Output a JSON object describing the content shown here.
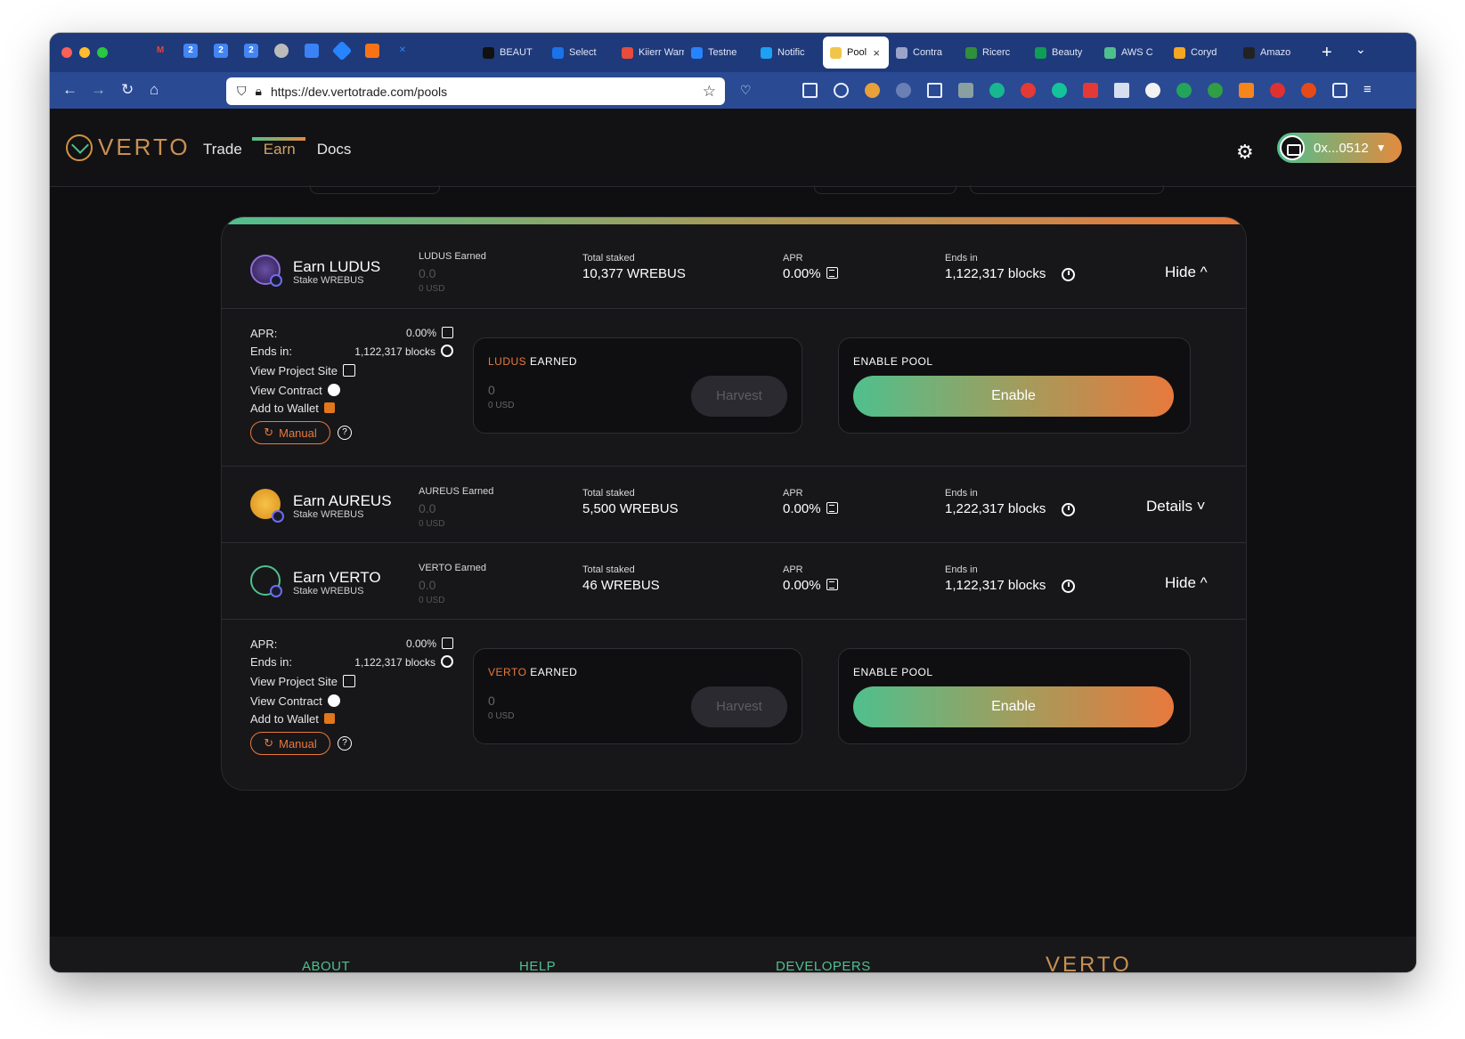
{
  "browser": {
    "tabs": [
      {
        "label": "BEAUT",
        "color": "#111111"
      },
      {
        "label": "Select",
        "color": "#1a73e8"
      },
      {
        "label": "Kiierr Warr",
        "color": "#e74c3c"
      },
      {
        "label": "Testne",
        "color": "#2684ff"
      },
      {
        "label": "Notific",
        "color": "#1da1f2"
      },
      {
        "label": "Pool",
        "color": "#f0c64a",
        "active": true
      },
      {
        "label": "Contra",
        "color": "#9aa4c8"
      },
      {
        "label": "Ricerc",
        "color": "#2f8f3a"
      },
      {
        "label": "Beauty",
        "color": "#0f9d58"
      },
      {
        "label": "AWS C",
        "color": "#4fc08d"
      },
      {
        "label": "Coryd",
        "color": "#f5a623"
      },
      {
        "label": "Amazo",
        "color": "#222222"
      }
    ],
    "url": "https://dev.vertotrade.com/pools"
  },
  "header": {
    "logo_text": "VERTO",
    "nav": [
      "Trade",
      "Earn",
      "Docs"
    ],
    "active_nav": "Earn",
    "wallet": "0x...0512"
  },
  "pools": [
    {
      "title": "Earn LUDUS",
      "sub": "Stake WREBUS",
      "earned_label": "LUDUS Earned",
      "earned_value": "0.0",
      "earned_usd": "0 USD",
      "staked_label": "Total staked",
      "staked": "10,377 WREBUS",
      "apr_label": "APR",
      "apr": "0.00%",
      "ends_label": "Ends in",
      "ends": "1,122,317 blocks",
      "toggle": "Hide ^",
      "expanded": true,
      "detail": {
        "apr_key": "APR:",
        "apr_val": "0.00%",
        "ends_key": "Ends in:",
        "ends_val": "1,122,317 blocks",
        "project_site": "View Project Site",
        "contract": "View Contract",
        "wallet": "Add to Wallet",
        "manual": "Manual",
        "earned_token": "LUDUS",
        "earned_title": " EARNED",
        "earned_zero": "0",
        "earned_usd": "0 USD",
        "harvest": "Harvest",
        "enable_title": "ENABLE POOL",
        "enable": "Enable"
      }
    },
    {
      "title": "Earn AUREUS",
      "sub": "Stake WREBUS",
      "earned_label": "AUREUS Earned",
      "earned_value": "0.0",
      "earned_usd": "0 USD",
      "staked_label": "Total staked",
      "staked": "5,500 WREBUS",
      "apr_label": "APR",
      "apr": "0.00%",
      "ends_label": "Ends in",
      "ends": "1,222,317 blocks",
      "toggle": "Details ˅",
      "expanded": false
    },
    {
      "title": "Earn VERTO",
      "sub": "Stake WREBUS",
      "earned_label": "VERTO Earned",
      "earned_value": "0.0",
      "earned_usd": "0 USD",
      "staked_label": "Total staked",
      "staked": "46 WREBUS",
      "apr_label": "APR",
      "apr": "0.00%",
      "ends_label": "Ends in",
      "ends": "1,122,317 blocks",
      "toggle": "Hide ^",
      "expanded": true,
      "detail": {
        "apr_key": "APR:",
        "apr_val": "0.00%",
        "ends_key": "Ends in:",
        "ends_val": "1,122,317 blocks",
        "project_site": "View Project Site",
        "contract": "View Contract",
        "wallet": "Add to Wallet",
        "manual": "Manual",
        "earned_token": "VERTO",
        "earned_title": " EARNED",
        "earned_zero": "0",
        "earned_usd": "0 USD",
        "harvest": "Harvest",
        "enable_title": "ENABLE POOL",
        "enable": "Enable"
      }
    }
  ],
  "footer": {
    "about": "ABOUT",
    "help": "HELP",
    "developers": "DEVELOPERS",
    "logo": "VERTO"
  }
}
